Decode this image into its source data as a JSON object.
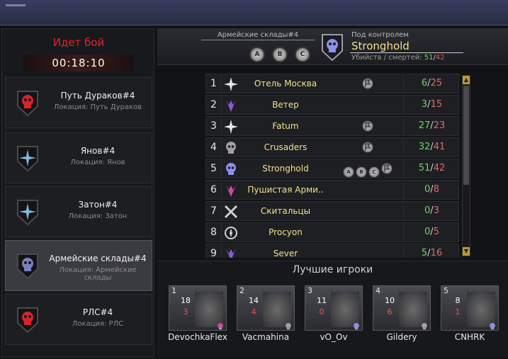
{
  "left": {
    "status": "Идет бой",
    "timer": "00:18:10",
    "locations": [
      {
        "name": "Путь Дураков#4",
        "location": "Локация: Путь Дураков",
        "emblem": "red-skull-icon",
        "active": false
      },
      {
        "name": "Янов#4",
        "location": "Локация: Янов",
        "emblem": "blue-star-icon",
        "active": false
      },
      {
        "name": "Затон#4",
        "location": "Локация: Затон",
        "emblem": "blue-star-icon",
        "active": false
      },
      {
        "name": "Армейские склады#4",
        "location": "Локация: Армейские склады",
        "emblem": "dark-skull-icon",
        "active": true
      },
      {
        "name": "РЛС#4",
        "location": "Локация: РЛС",
        "emblem": "red-skull-icon",
        "active": false
      }
    ]
  },
  "header": {
    "location": "Армейские склады#4",
    "points": [
      "A",
      "B",
      "C"
    ],
    "under_control_label": "Под контролем",
    "clan": "Stronghold",
    "kd_label": "Убийств / смертей:",
    "kills": "51",
    "deaths": "42"
  },
  "table": {
    "rows": [
      {
        "rank": "1",
        "clan": "Отель Москва",
        "icon": "star-emblem-icon",
        "flags": [
          "flag"
        ],
        "kills": "6",
        "deaths": "25"
      },
      {
        "rank": "2",
        "clan": "Ветер",
        "icon": "purple-emblem-icon",
        "flags": [],
        "kills": "3",
        "deaths": "15"
      },
      {
        "rank": "3",
        "clan": "Fatum",
        "icon": "star-emblem-icon",
        "flags": [
          "flag"
        ],
        "kills": "27",
        "deaths": "23"
      },
      {
        "rank": "4",
        "clan": "Crusaders",
        "icon": "skull-emblem-icon",
        "flags": [
          "flag"
        ],
        "kills": "32",
        "deaths": "41"
      },
      {
        "rank": "5",
        "clan": "Stronghold",
        "icon": "blue-skull-emblem-icon",
        "flags": [
          "A",
          "B",
          "C",
          "flag"
        ],
        "kills": "51",
        "deaths": "42"
      },
      {
        "rank": "6",
        "clan": "Пушистая Арми..",
        "icon": "pink-emblem-icon",
        "flags": [],
        "kills": "0",
        "deaths": "8"
      },
      {
        "rank": "7",
        "clan": "Скитальцы",
        "icon": "crossed-swords-icon",
        "flags": [],
        "kills": "0",
        "deaths": "3"
      },
      {
        "rank": "8",
        "clan": "Procyon",
        "icon": "wreath-emblem-icon",
        "flags": [],
        "kills": "0",
        "deaths": "5"
      },
      {
        "rank": "9",
        "clan": "Sever",
        "icon": "purple-emblem-icon",
        "flags": [],
        "kills": "5",
        "deaths": "16"
      }
    ]
  },
  "best_players": {
    "title": "Лучшие игроки",
    "players": [
      {
        "pos": "1",
        "kills": "18",
        "deaths": "3",
        "name": "DevochkaFlex",
        "clan_icon": "pink-emblem-icon"
      },
      {
        "pos": "2",
        "kills": "14",
        "deaths": "4",
        "name": "Vacmahina",
        "clan_icon": "skull-emblem-icon"
      },
      {
        "pos": "3",
        "kills": "11",
        "deaths": "0",
        "name": "vO_Ov",
        "clan_icon": "blue-skull-emblem-icon"
      },
      {
        "pos": "4",
        "kills": "10",
        "deaths": "6",
        "name": "Gildery",
        "clan_icon": "skull-emblem-icon"
      },
      {
        "pos": "5",
        "kills": "8",
        "deaths": "1",
        "name": "CNHRK",
        "clan_icon": "blue-skull-emblem-icon"
      }
    ]
  },
  "colors": {
    "accent": "#e0242a",
    "clan_gold": "#f2e08a",
    "kills": "#6fd36a",
    "deaths": "#e06a6a"
  }
}
